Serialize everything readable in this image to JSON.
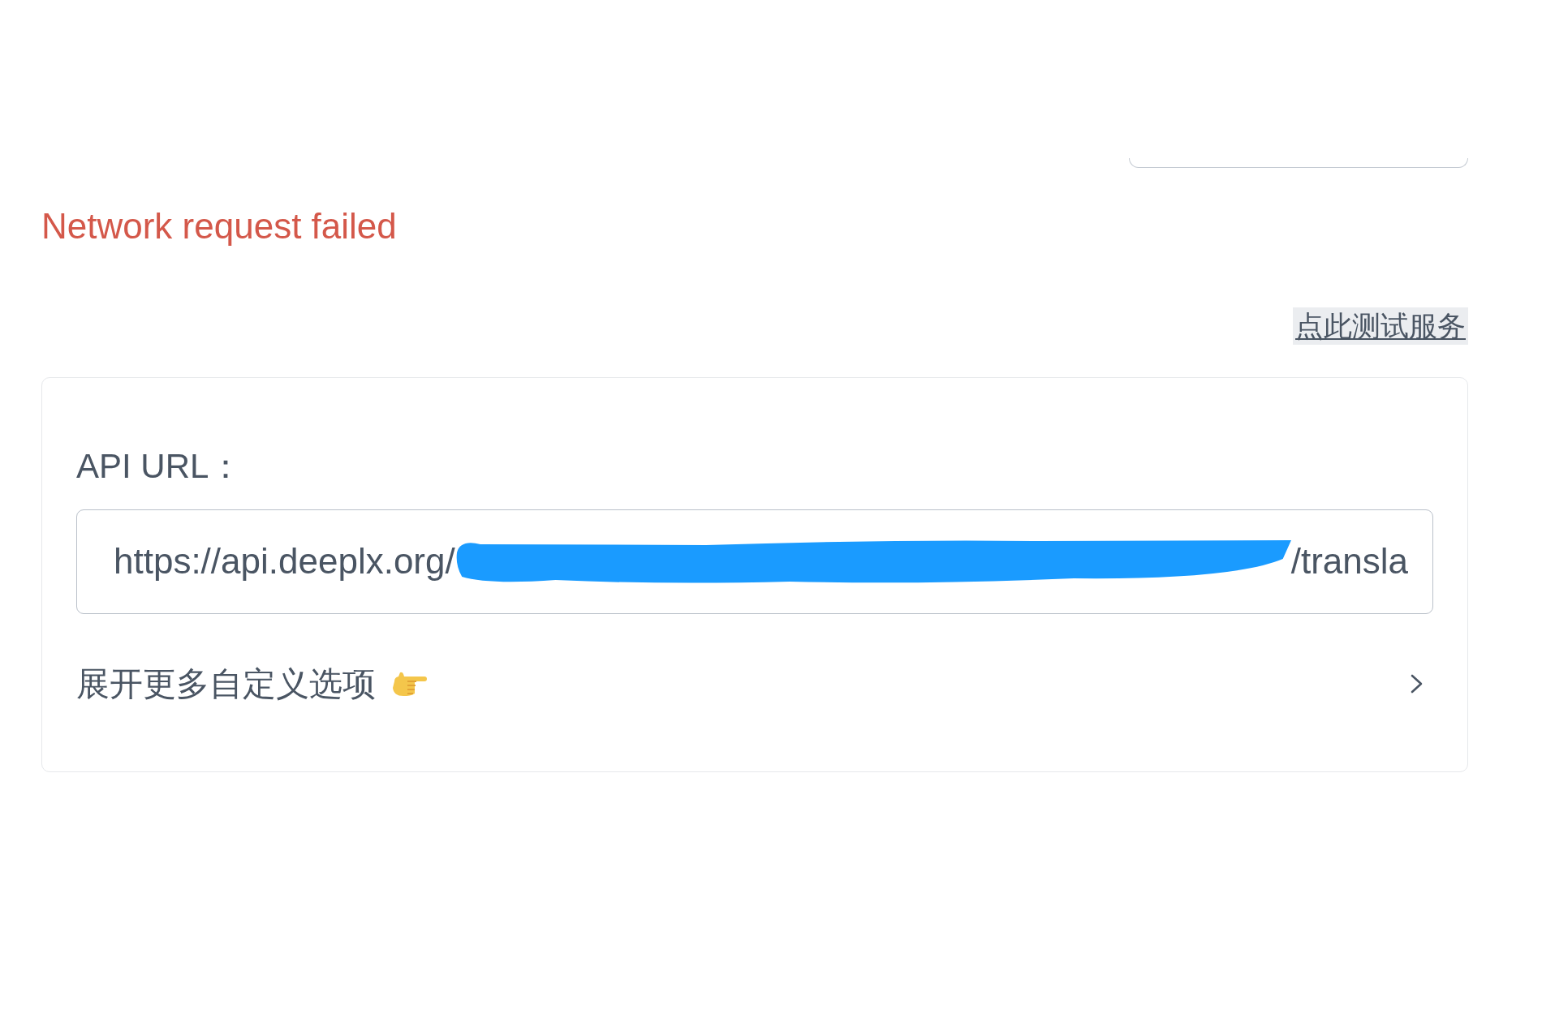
{
  "error": {
    "message": "Network request failed"
  },
  "test_button": {
    "label": "点此测试服务"
  },
  "settings_card": {
    "api_url": {
      "label": "API URL：",
      "value_start": "https://api.deeplx.org/",
      "redacted": true,
      "value_end": "/transla"
    },
    "more_options": {
      "label": "展开更多自定义选项",
      "expanded": false
    }
  }
}
